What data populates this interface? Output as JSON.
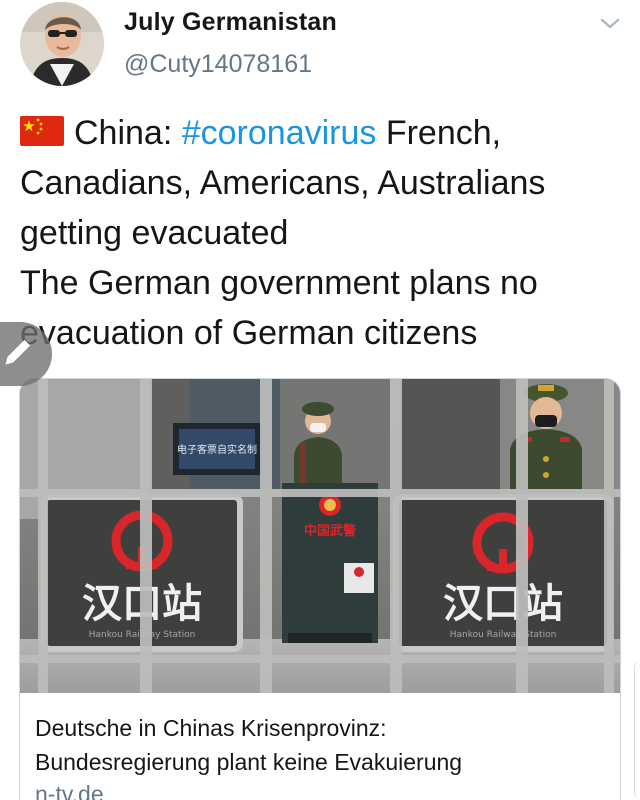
{
  "tweet": {
    "display_name": "July Germanistan",
    "handle": "@Cuty14078161",
    "flag_icon": "china-flag-icon",
    "line1_prefix": "China: ",
    "hashtag": "#coronavirus",
    "line1_suffix": " French,",
    "line2": "Canadians, Americans, Australians",
    "line3": "getting evacuated",
    "line4": "The German government plans no",
    "line5": "evacuation of German citizens"
  },
  "card": {
    "title_line1": "Deutsche in Chinas Krisenprovinz:",
    "title_line2": "Bundesregierung plant keine Evakuierung",
    "domain": "n-tv.de",
    "image_sign_text": "汉口站",
    "image_sign_subtext": "Hankou Railway Station",
    "image_badge_text": "中国武警",
    "image_screen_text": "电子客票自实名制"
  },
  "colors": {
    "text": "#14171a",
    "secondary": "#657786",
    "hashtag": "#1b95e0",
    "card_border": "#ccd6dd",
    "sign_red": "#d8262a",
    "uniform_green": "#3c4a30"
  },
  "icons": {
    "menu_chevron": "chevron-down-icon",
    "edit": "pencil-icon"
  }
}
